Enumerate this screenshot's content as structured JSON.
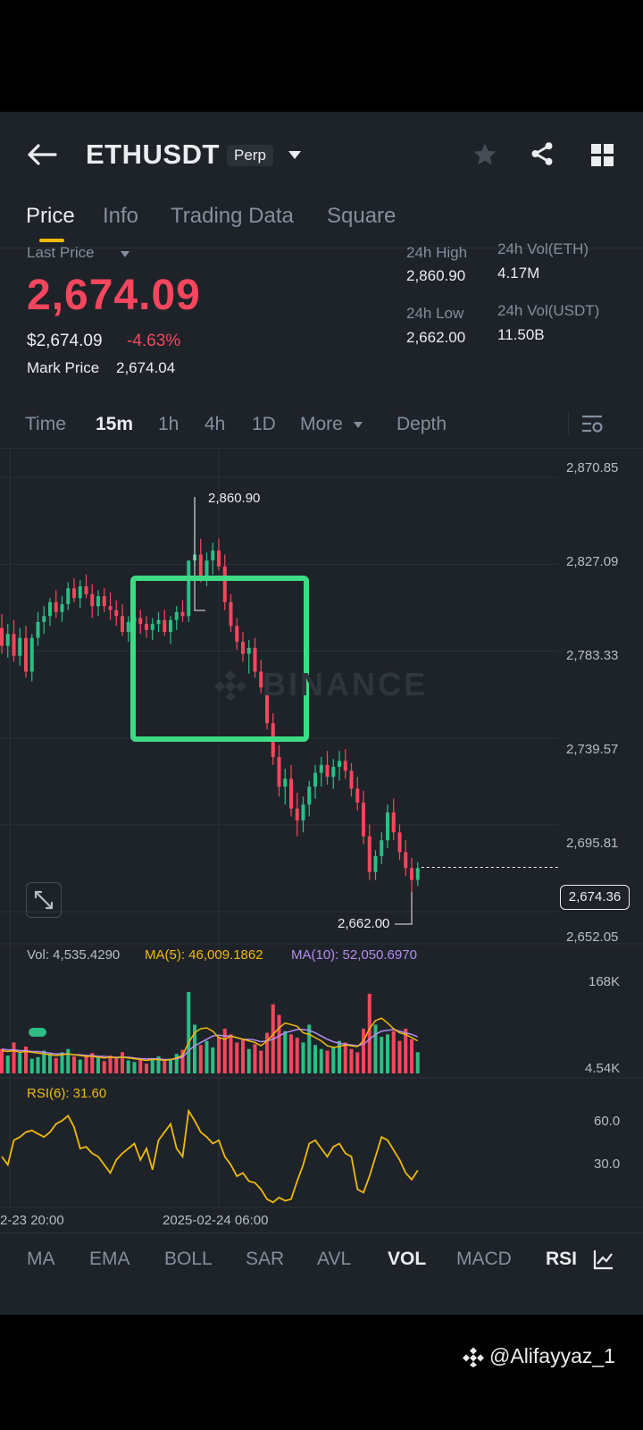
{
  "header": {
    "title": "ETHUSDT",
    "badge": "Perp"
  },
  "tabs": [
    {
      "label": "Price",
      "active": true
    },
    {
      "label": "Info"
    },
    {
      "label": "Trading Data"
    },
    {
      "label": "Square"
    }
  ],
  "price": {
    "last_price_label": "Last Price",
    "last_price": "2,674.09",
    "usd_price": "$2,674.09",
    "change": "-4.63%",
    "mark_price_label": "Mark Price",
    "mark_price": "2,674.04"
  },
  "stats": {
    "high_label": "24h High",
    "high": "2,860.90",
    "low_label": "24h Low",
    "low": "2,662.00",
    "vol_eth_label": "24h Vol(ETH)",
    "vol_eth": "4.17M",
    "vol_usdt_label": "24h Vol(USDT)",
    "vol_usdt": "11.50B"
  },
  "timeframes": [
    "Time",
    "15m",
    "1h",
    "4h",
    "1D",
    "More",
    "Depth"
  ],
  "active_timeframe": "15m",
  "chart": {
    "price_axis": [
      "2,870.85",
      "2,827.09",
      "2,783.33",
      "2,739.57",
      "2,695.81",
      "2,652.05"
    ],
    "current_price_tag": "2,674.36",
    "high_marker": "2,860.90",
    "low_marker": "2,662.00",
    "watermark": "BINANCE",
    "vol_label": "Vol: 4,535.4290",
    "ma5_label": "MA(5): 46,009.1862",
    "ma10_label": "MA(10): 52,050.6970",
    "vol_axis": [
      "168K",
      "4.54K"
    ],
    "rsi_label": "RSI(6): 31.60",
    "rsi_axis": [
      "60.0",
      "30.0"
    ],
    "dates": [
      "2-23 20:00",
      "2025-02-24 06:00"
    ]
  },
  "indicator_tabs": [
    "MA",
    "EMA",
    "BOLL",
    "SAR",
    "AVL",
    "VOL",
    "MACD",
    "RSI"
  ],
  "active_indicator": "VOL",
  "footer_handle": "@Alifayyaz_1",
  "colors": {
    "up": "#2ebd85",
    "down": "#f6465d",
    "accent": "#f0b90b",
    "highlight_box": "#3ddc84",
    "ma10": "#b48cf0"
  },
  "chart_data": {
    "type": "candlestick",
    "symbol": "ETHUSDT",
    "interval": "15m",
    "ylim": [
      2648,
      2875
    ],
    "candles": [
      [
        2795,
        2802,
        2782,
        2786
      ],
      [
        2786,
        2797,
        2780,
        2792
      ],
      [
        2792,
        2799,
        2778,
        2781
      ],
      [
        2781,
        2795,
        2776,
        2790
      ],
      [
        2790,
        2796,
        2770,
        2773
      ],
      [
        2773,
        2792,
        2768,
        2790
      ],
      [
        2790,
        2803,
        2786,
        2798
      ],
      [
        2798,
        2806,
        2792,
        2801
      ],
      [
        2801,
        2810,
        2796,
        2808
      ],
      [
        2808,
        2814,
        2800,
        2803
      ],
      [
        2803,
        2811,
        2798,
        2807
      ],
      [
        2807,
        2818,
        2804,
        2815
      ],
      [
        2815,
        2820,
        2808,
        2810
      ],
      [
        2810,
        2819,
        2805,
        2816
      ],
      [
        2816,
        2822,
        2810,
        2812
      ],
      [
        2812,
        2817,
        2800,
        2806
      ],
      [
        2806,
        2814,
        2801,
        2811
      ],
      [
        2811,
        2815,
        2803,
        2806
      ],
      [
        2806,
        2813,
        2799,
        2804
      ],
      [
        2804,
        2809,
        2796,
        2801
      ],
      [
        2801,
        2807,
        2791,
        2793
      ],
      [
        2793,
        2801,
        2788,
        2798
      ],
      [
        2798,
        2806,
        2794,
        2800
      ],
      [
        2800,
        2804,
        2792,
        2797
      ],
      [
        2797,
        2801,
        2790,
        2794
      ],
      [
        2794,
        2800,
        2789,
        2797
      ],
      [
        2797,
        2803,
        2793,
        2799
      ],
      [
        2799,
        2804,
        2791,
        2793
      ],
      [
        2793,
        2801,
        2787,
        2799
      ],
      [
        2799,
        2806,
        2794,
        2803
      ],
      [
        2803,
        2809,
        2798,
        2801
      ],
      [
        2801,
        2815,
        2798,
        2829
      ],
      [
        2829,
        2861,
        2826,
        2832
      ],
      [
        2832,
        2840,
        2818,
        2821
      ],
      [
        2821,
        2833,
        2816,
        2829
      ],
      [
        2829,
        2838,
        2822,
        2834
      ],
      [
        2834,
        2840,
        2824,
        2826
      ],
      [
        2826,
        2832,
        2804,
        2808
      ],
      [
        2808,
        2812,
        2793,
        2796
      ],
      [
        2796,
        2800,
        2784,
        2788
      ],
      [
        2788,
        2793,
        2778,
        2782
      ],
      [
        2782,
        2789,
        2772,
        2785
      ],
      [
        2785,
        2790,
        2770,
        2773
      ],
      [
        2773,
        2779,
        2762,
        2765
      ],
      [
        2765,
        2770,
        2744,
        2747
      ],
      [
        2747,
        2752,
        2726,
        2730
      ],
      [
        2730,
        2736,
        2710,
        2715
      ],
      [
        2715,
        2724,
        2706,
        2719
      ],
      [
        2719,
        2726,
        2700,
        2704
      ],
      [
        2704,
        2712,
        2690,
        2698
      ],
      [
        2698,
        2710,
        2692,
        2706
      ],
      [
        2706,
        2718,
        2700,
        2715
      ],
      [
        2715,
        2726,
        2709,
        2722
      ],
      [
        2722,
        2730,
        2715,
        2726
      ],
      [
        2726,
        2733,
        2716,
        2720
      ],
      [
        2720,
        2729,
        2714,
        2725
      ],
      [
        2725,
        2733,
        2718,
        2728
      ],
      [
        2728,
        2734,
        2719,
        2723
      ],
      [
        2723,
        2727,
        2710,
        2714
      ],
      [
        2714,
        2720,
        2703,
        2707
      ],
      [
        2707,
        2713,
        2686,
        2690
      ],
      [
        2690,
        2696,
        2668,
        2672
      ],
      [
        2672,
        2683,
        2668,
        2680
      ],
      [
        2680,
        2692,
        2676,
        2688
      ],
      [
        2688,
        2706,
        2684,
        2702
      ],
      [
        2702,
        2709,
        2688,
        2692
      ],
      [
        2692,
        2696,
        2678,
        2682
      ],
      [
        2682,
        2688,
        2670,
        2674
      ],
      [
        2674,
        2679,
        2662,
        2668
      ],
      [
        2668,
        2677,
        2665,
        2674
      ]
    ],
    "volume_ylim": [
      4540,
      168000
    ],
    "volume_k": [
      30,
      22,
      38,
      25,
      33,
      18,
      20,
      28,
      24,
      19,
      26,
      30,
      21,
      17,
      23,
      25,
      20,
      15,
      22,
      18,
      26,
      16,
      14,
      19,
      12,
      17,
      21,
      15,
      18,
      24,
      29,
      100,
      60,
      35,
      40,
      32,
      45,
      55,
      48,
      38,
      42,
      30,
      36,
      28,
      50,
      85,
      72,
      52,
      48,
      44,
      38,
      60,
      35,
      30,
      28,
      32,
      40,
      38,
      30,
      26,
      55,
      98,
      60,
      45,
      48,
      52,
      40,
      55,
      42,
      26
    ],
    "ma5_k": [
      28,
      27,
      28,
      26,
      27,
      26,
      25,
      24,
      23,
      22,
      23,
      24,
      23,
      22,
      21,
      21,
      20,
      19,
      20,
      19,
      20,
      19,
      18,
      17,
      16,
      17,
      17,
      16,
      17,
      19,
      22,
      38,
      50,
      55,
      56,
      52,
      44,
      42,
      46,
      44,
      42,
      40,
      38,
      34,
      40,
      48,
      56,
      62,
      60,
      58,
      50,
      48,
      44,
      40,
      34,
      32,
      33,
      35,
      34,
      33,
      40,
      55,
      65,
      68,
      62,
      55,
      50,
      48,
      44,
      40
    ],
    "ma10_k": [
      30,
      29,
      29,
      28,
      28,
      27,
      27,
      26,
      25,
      24,
      24,
      24,
      23,
      23,
      22,
      22,
      21,
      21,
      20,
      20,
      20,
      20,
      19,
      18,
      18,
      18,
      18,
      17,
      17,
      18,
      20,
      28,
      34,
      38,
      42,
      46,
      47,
      46,
      46,
      44,
      42,
      42,
      41,
      39,
      40,
      42,
      46,
      50,
      52,
      54,
      54,
      53,
      50,
      46,
      42,
      39,
      37,
      36,
      35,
      34,
      36,
      42,
      48,
      52,
      53,
      54,
      52,
      50,
      48,
      45
    ],
    "rsi_ylim": [
      10,
      80
    ],
    "rsi": [
      40,
      35,
      50,
      52,
      55,
      56,
      54,
      52,
      55,
      60,
      62,
      65,
      58,
      45,
      46,
      42,
      40,
      35,
      30,
      38,
      42,
      45,
      48,
      38,
      45,
      32,
      50,
      55,
      60,
      45,
      40,
      68,
      62,
      55,
      52,
      48,
      50,
      40,
      35,
      28,
      30,
      25,
      24,
      20,
      14,
      12,
      15,
      13,
      14,
      25,
      35,
      48,
      50,
      45,
      40,
      46,
      48,
      42,
      40,
      20,
      18,
      28,
      40,
      52,
      50,
      44,
      38,
      30,
      26,
      31.6
    ]
  }
}
